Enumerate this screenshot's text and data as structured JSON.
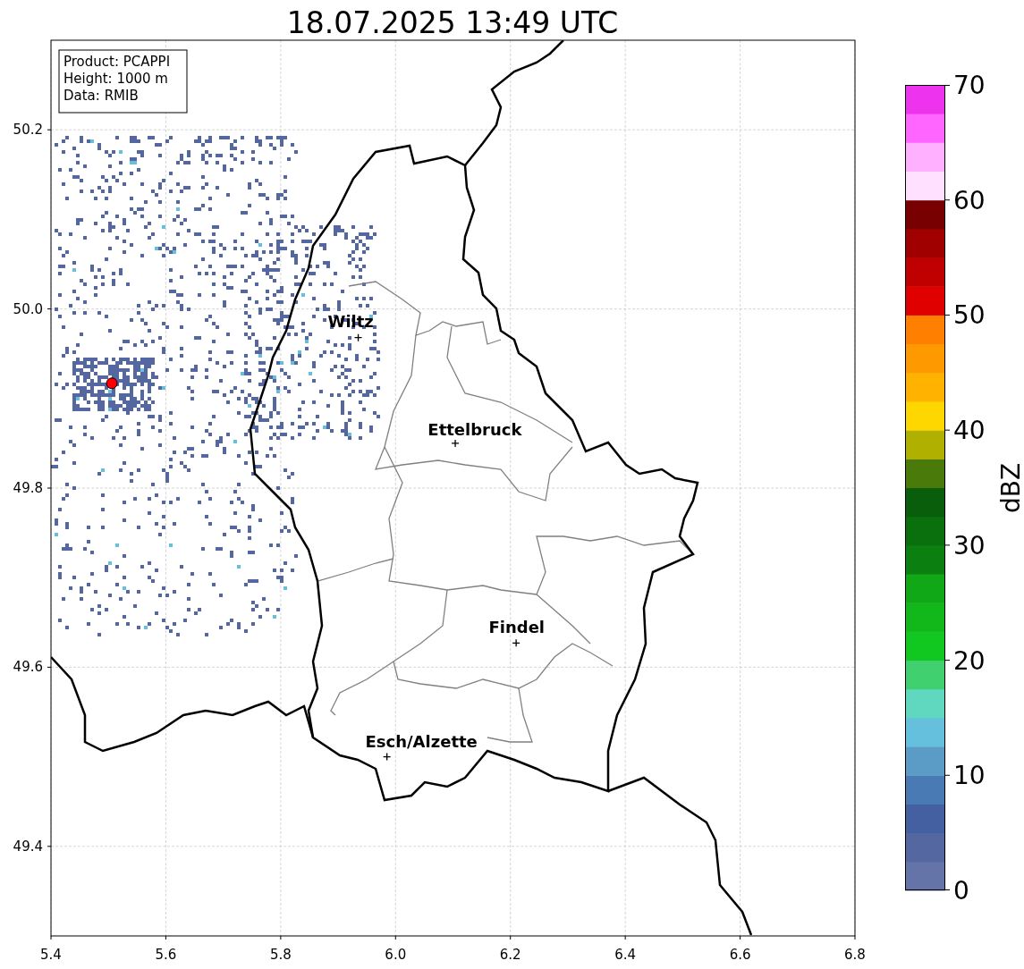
{
  "title": "18.07.2025 13:49 UTC",
  "info_box": [
    "Product: PCAPPI",
    "Height: 1000 m",
    "Data: RMIB"
  ],
  "map": {
    "yticks": [
      "50.2",
      "50.0",
      "49.8",
      "49.6",
      "49.4"
    ],
    "xticks": [
      "5.4",
      "5.6",
      "5.8",
      "6.0",
      "6.2",
      "6.4",
      "6.6",
      "6.8"
    ],
    "cities": [
      {
        "name": "Wiltz"
      },
      {
        "name": "Ettelbruck"
      },
      {
        "name": "Findel"
      },
      {
        "name": "Esch/Alzette"
      }
    ]
  },
  "colorbar": {
    "label": "dBZ",
    "ticks": [
      "70",
      "60",
      "50",
      "40",
      "30",
      "20",
      "10",
      "0"
    ]
  }
}
